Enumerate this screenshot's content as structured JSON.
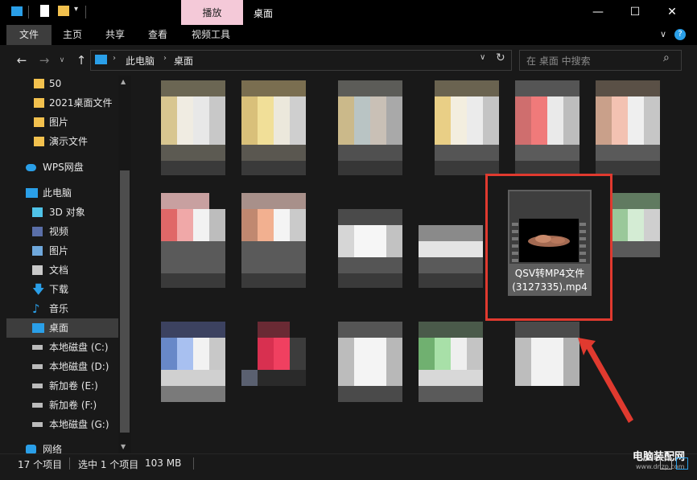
{
  "window": {
    "contextual_tab": "播放",
    "title": "桌面",
    "minimize_glyph": "—",
    "maximize_glyph": "☐",
    "close_glyph": "✕"
  },
  "ribbon": {
    "tabs": [
      {
        "label": "文件"
      },
      {
        "label": "主页"
      },
      {
        "label": "共享"
      },
      {
        "label": "查看"
      },
      {
        "label": "视频工具"
      }
    ]
  },
  "address": {
    "breadcrumbs": [
      "此电脑",
      "桌面"
    ],
    "search_placeholder": "在 桌面 中搜索"
  },
  "nav": {
    "items": [
      {
        "label": "50",
        "icon": "folder-icon"
      },
      {
        "label": "2021桌面文件",
        "icon": "folder-icon"
      },
      {
        "label": "图片",
        "icon": "folder-icon"
      },
      {
        "label": "演示文件",
        "icon": "folder-icon"
      },
      {
        "label": "WPS网盘",
        "icon": "cloud-icon"
      },
      {
        "label": "此电脑",
        "icon": "computer-icon"
      },
      {
        "label": "3D 对象",
        "icon": "cube-icon"
      },
      {
        "label": "视频",
        "icon": "video-icon"
      },
      {
        "label": "图片",
        "icon": "picture-icon"
      },
      {
        "label": "文档",
        "icon": "document-icon"
      },
      {
        "label": "下载",
        "icon": "download-icon"
      },
      {
        "label": "音乐",
        "icon": "music-icon"
      },
      {
        "label": "桌面",
        "icon": "desktop-icon"
      },
      {
        "label": "本地磁盘 (C:)",
        "icon": "drive-icon"
      },
      {
        "label": "本地磁盘 (D:)",
        "icon": "drive-icon"
      },
      {
        "label": "新加卷 (E:)",
        "icon": "drive-icon"
      },
      {
        "label": "新加卷 (F:)",
        "icon": "drive-icon"
      },
      {
        "label": "本地磁盘 (G:)",
        "icon": "drive-icon"
      },
      {
        "label": "网络",
        "icon": "network-icon"
      }
    ]
  },
  "selected_file": {
    "name_line1": "QSV转MP4文件",
    "name_line2": "(3127335).mp4"
  },
  "status": {
    "count": "17 个项目",
    "selection": "选中 1 个项目",
    "size": "103 MB"
  },
  "watermark": {
    "cn": "电脑装配网",
    "url": "www.dnzp.com"
  },
  "colors": {
    "highlight_box": "#e03a2f",
    "contextual_tab_bg": "#f4c9d8",
    "folder": "#f2c14e",
    "accent_blue": "#2a9fe8"
  }
}
